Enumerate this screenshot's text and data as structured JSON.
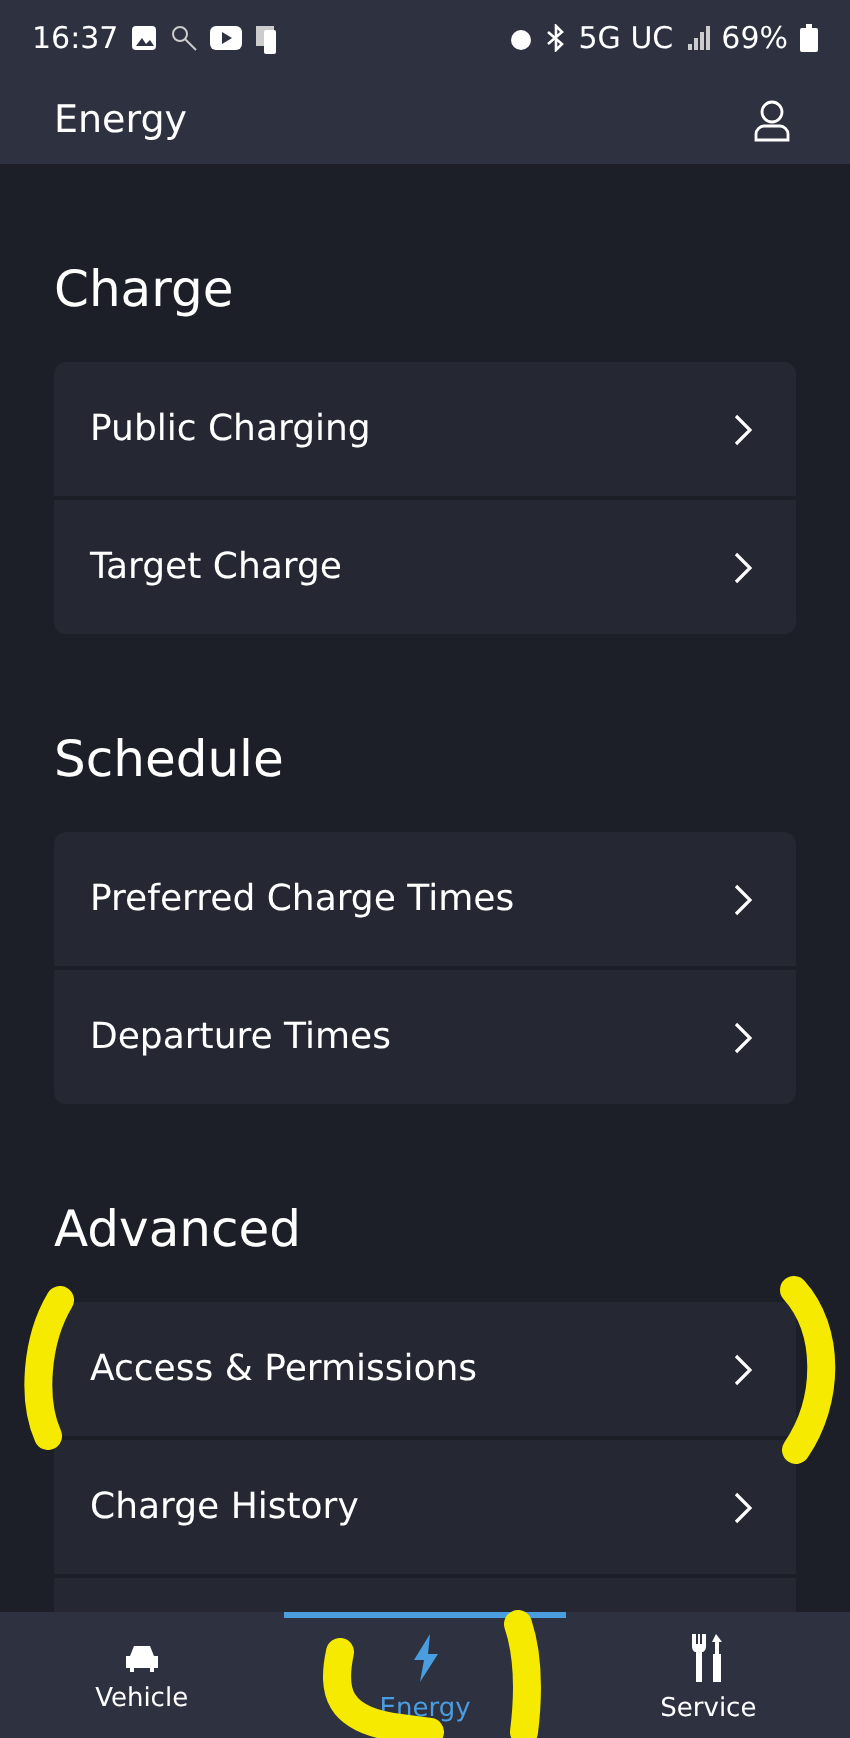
{
  "status_bar": {
    "time": "16:37",
    "network": "5G UC",
    "battery": "69%"
  },
  "header": {
    "title": "Energy"
  },
  "sections": [
    {
      "title": "Charge",
      "items": [
        {
          "label": "Public Charging"
        },
        {
          "label": "Target Charge"
        }
      ]
    },
    {
      "title": "Schedule",
      "items": [
        {
          "label": "Preferred Charge Times"
        },
        {
          "label": "Departure Times"
        }
      ]
    },
    {
      "title": "Advanced",
      "items": [
        {
          "label": "Access & Permissions"
        },
        {
          "label": "Charge History"
        }
      ]
    }
  ],
  "nav": [
    {
      "label": "Vehicle",
      "kind": "vehicle",
      "selected": false
    },
    {
      "label": "Energy",
      "kind": "energy",
      "selected": true
    },
    {
      "label": "Service",
      "kind": "service",
      "selected": false
    }
  ]
}
